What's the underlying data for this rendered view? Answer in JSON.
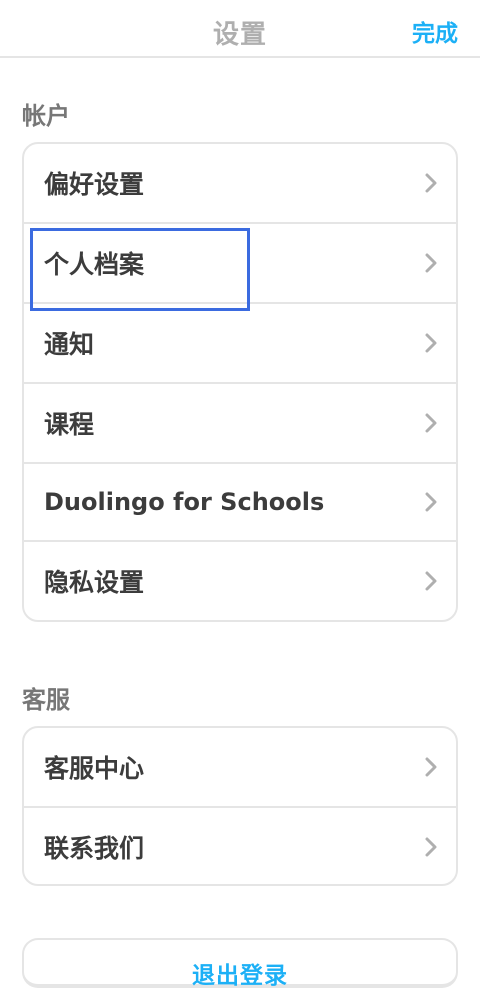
{
  "header": {
    "title": "设置",
    "done_label": "完成"
  },
  "account": {
    "section_title": "帐户",
    "items": [
      {
        "label": "偏好设置"
      },
      {
        "label": "个人档案"
      },
      {
        "label": "通知"
      },
      {
        "label": "课程"
      },
      {
        "label": "Duolingo for Schools"
      },
      {
        "label": "隐私设置"
      }
    ]
  },
  "support": {
    "section_title": "客服",
    "items": [
      {
        "label": "客服中心"
      },
      {
        "label": "联系我们"
      }
    ]
  },
  "logout": {
    "label": "退出登录"
  },
  "icons": {
    "row_arrow": "chevron-right-icon"
  },
  "colors": {
    "accent": "#1cb0f6",
    "text": "#3c3c3c",
    "muted": "#777777",
    "border": "#e5e5e5",
    "highlight": "#3b6be0"
  }
}
